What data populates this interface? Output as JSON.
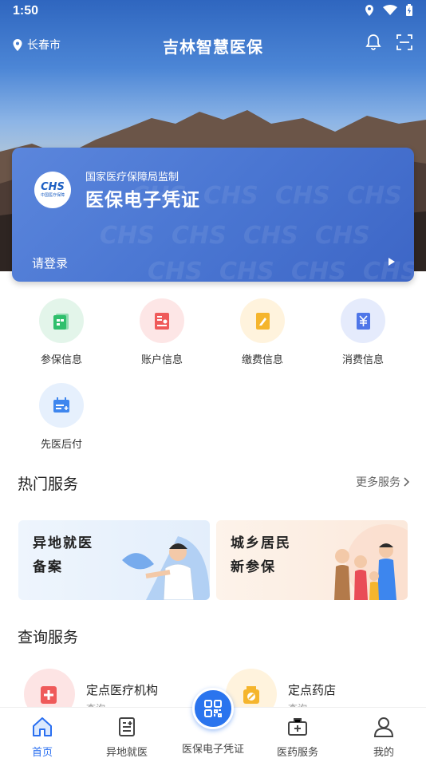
{
  "status": {
    "time": "1:50"
  },
  "topbar": {
    "location": "长春市",
    "title": "吉林智慧医保"
  },
  "card": {
    "subtitle": "国家医疗保障局监制",
    "title": "医保电子凭证",
    "login": "请登录",
    "logo_text": "CHS",
    "logo_sub": "中国医疗保障"
  },
  "quick": [
    {
      "label": "参保信息",
      "icon": "insurance-doc-icon",
      "bg": "#e3f5ea",
      "fg": "#2fbf6c"
    },
    {
      "label": "账户信息",
      "icon": "account-card-icon",
      "bg": "#fde6e6",
      "fg": "#ef5a5a"
    },
    {
      "label": "缴费信息",
      "icon": "payment-note-icon",
      "bg": "#fff3dd",
      "fg": "#f5b52d"
    },
    {
      "label": "消费信息",
      "icon": "yuan-receipt-icon",
      "bg": "#e5ebfc",
      "fg": "#4f76e8"
    },
    {
      "label": "先医后付",
      "icon": "calendar-card-icon",
      "bg": "#e6f0fd",
      "fg": "#3e86ee"
    }
  ],
  "hot": {
    "title": "热门服务",
    "more": "更多服务",
    "banners": [
      {
        "line1": "异地就医",
        "line2": "备案"
      },
      {
        "line1": "城乡居民",
        "line2": "新参保"
      }
    ]
  },
  "query": {
    "title": "查询服务",
    "items": [
      {
        "title": "定点医疗机构",
        "sub": "查询"
      },
      {
        "title": "定点药店",
        "sub": "查询"
      }
    ]
  },
  "nav": {
    "items": [
      "首页",
      "异地就医",
      "医保电子凭证",
      "医药服务",
      "我的"
    ],
    "active_color": "#2a6ff0"
  }
}
